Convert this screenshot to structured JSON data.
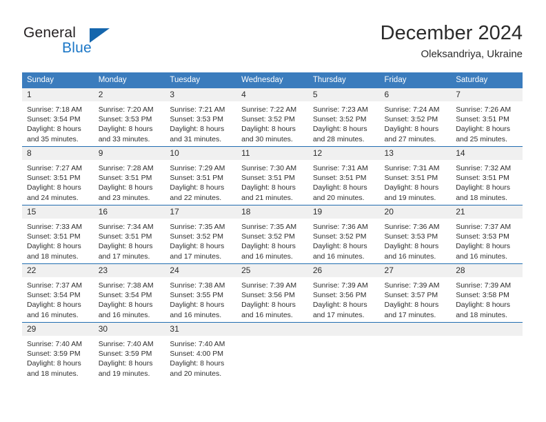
{
  "brand": {
    "name_part1": "General",
    "name_part2": "Blue"
  },
  "header": {
    "title": "December 2024",
    "location": "Oleksandriya, Ukraine"
  },
  "colors": {
    "header_blue": "#3b7cbd",
    "rule_blue": "#1f6cb0",
    "daynum_gray": "#f0f0f0",
    "logo_blue": "#1a76c6"
  },
  "weekdays": [
    "Sunday",
    "Monday",
    "Tuesday",
    "Wednesday",
    "Thursday",
    "Friday",
    "Saturday"
  ],
  "weeks": [
    [
      {
        "day": "1",
        "sunrise": "Sunrise: 7:18 AM",
        "sunset": "Sunset: 3:54 PM",
        "daylight1": "Daylight: 8 hours",
        "daylight2": "and 35 minutes."
      },
      {
        "day": "2",
        "sunrise": "Sunrise: 7:20 AM",
        "sunset": "Sunset: 3:53 PM",
        "daylight1": "Daylight: 8 hours",
        "daylight2": "and 33 minutes."
      },
      {
        "day": "3",
        "sunrise": "Sunrise: 7:21 AM",
        "sunset": "Sunset: 3:53 PM",
        "daylight1": "Daylight: 8 hours",
        "daylight2": "and 31 minutes."
      },
      {
        "day": "4",
        "sunrise": "Sunrise: 7:22 AM",
        "sunset": "Sunset: 3:52 PM",
        "daylight1": "Daylight: 8 hours",
        "daylight2": "and 30 minutes."
      },
      {
        "day": "5",
        "sunrise": "Sunrise: 7:23 AM",
        "sunset": "Sunset: 3:52 PM",
        "daylight1": "Daylight: 8 hours",
        "daylight2": "and 28 minutes."
      },
      {
        "day": "6",
        "sunrise": "Sunrise: 7:24 AM",
        "sunset": "Sunset: 3:52 PM",
        "daylight1": "Daylight: 8 hours",
        "daylight2": "and 27 minutes."
      },
      {
        "day": "7",
        "sunrise": "Sunrise: 7:26 AM",
        "sunset": "Sunset: 3:51 PM",
        "daylight1": "Daylight: 8 hours",
        "daylight2": "and 25 minutes."
      }
    ],
    [
      {
        "day": "8",
        "sunrise": "Sunrise: 7:27 AM",
        "sunset": "Sunset: 3:51 PM",
        "daylight1": "Daylight: 8 hours",
        "daylight2": "and 24 minutes."
      },
      {
        "day": "9",
        "sunrise": "Sunrise: 7:28 AM",
        "sunset": "Sunset: 3:51 PM",
        "daylight1": "Daylight: 8 hours",
        "daylight2": "and 23 minutes."
      },
      {
        "day": "10",
        "sunrise": "Sunrise: 7:29 AM",
        "sunset": "Sunset: 3:51 PM",
        "daylight1": "Daylight: 8 hours",
        "daylight2": "and 22 minutes."
      },
      {
        "day": "11",
        "sunrise": "Sunrise: 7:30 AM",
        "sunset": "Sunset: 3:51 PM",
        "daylight1": "Daylight: 8 hours",
        "daylight2": "and 21 minutes."
      },
      {
        "day": "12",
        "sunrise": "Sunrise: 7:31 AM",
        "sunset": "Sunset: 3:51 PM",
        "daylight1": "Daylight: 8 hours",
        "daylight2": "and 20 minutes."
      },
      {
        "day": "13",
        "sunrise": "Sunrise: 7:31 AM",
        "sunset": "Sunset: 3:51 PM",
        "daylight1": "Daylight: 8 hours",
        "daylight2": "and 19 minutes."
      },
      {
        "day": "14",
        "sunrise": "Sunrise: 7:32 AM",
        "sunset": "Sunset: 3:51 PM",
        "daylight1": "Daylight: 8 hours",
        "daylight2": "and 18 minutes."
      }
    ],
    [
      {
        "day": "15",
        "sunrise": "Sunrise: 7:33 AM",
        "sunset": "Sunset: 3:51 PM",
        "daylight1": "Daylight: 8 hours",
        "daylight2": "and 18 minutes."
      },
      {
        "day": "16",
        "sunrise": "Sunrise: 7:34 AM",
        "sunset": "Sunset: 3:51 PM",
        "daylight1": "Daylight: 8 hours",
        "daylight2": "and 17 minutes."
      },
      {
        "day": "17",
        "sunrise": "Sunrise: 7:35 AM",
        "sunset": "Sunset: 3:52 PM",
        "daylight1": "Daylight: 8 hours",
        "daylight2": "and 17 minutes."
      },
      {
        "day": "18",
        "sunrise": "Sunrise: 7:35 AM",
        "sunset": "Sunset: 3:52 PM",
        "daylight1": "Daylight: 8 hours",
        "daylight2": "and 16 minutes."
      },
      {
        "day": "19",
        "sunrise": "Sunrise: 7:36 AM",
        "sunset": "Sunset: 3:52 PM",
        "daylight1": "Daylight: 8 hours",
        "daylight2": "and 16 minutes."
      },
      {
        "day": "20",
        "sunrise": "Sunrise: 7:36 AM",
        "sunset": "Sunset: 3:53 PM",
        "daylight1": "Daylight: 8 hours",
        "daylight2": "and 16 minutes."
      },
      {
        "day": "21",
        "sunrise": "Sunrise: 7:37 AM",
        "sunset": "Sunset: 3:53 PM",
        "daylight1": "Daylight: 8 hours",
        "daylight2": "and 16 minutes."
      }
    ],
    [
      {
        "day": "22",
        "sunrise": "Sunrise: 7:37 AM",
        "sunset": "Sunset: 3:54 PM",
        "daylight1": "Daylight: 8 hours",
        "daylight2": "and 16 minutes."
      },
      {
        "day": "23",
        "sunrise": "Sunrise: 7:38 AM",
        "sunset": "Sunset: 3:54 PM",
        "daylight1": "Daylight: 8 hours",
        "daylight2": "and 16 minutes."
      },
      {
        "day": "24",
        "sunrise": "Sunrise: 7:38 AM",
        "sunset": "Sunset: 3:55 PM",
        "daylight1": "Daylight: 8 hours",
        "daylight2": "and 16 minutes."
      },
      {
        "day": "25",
        "sunrise": "Sunrise: 7:39 AM",
        "sunset": "Sunset: 3:56 PM",
        "daylight1": "Daylight: 8 hours",
        "daylight2": "and 16 minutes."
      },
      {
        "day": "26",
        "sunrise": "Sunrise: 7:39 AM",
        "sunset": "Sunset: 3:56 PM",
        "daylight1": "Daylight: 8 hours",
        "daylight2": "and 17 minutes."
      },
      {
        "day": "27",
        "sunrise": "Sunrise: 7:39 AM",
        "sunset": "Sunset: 3:57 PM",
        "daylight1": "Daylight: 8 hours",
        "daylight2": "and 17 minutes."
      },
      {
        "day": "28",
        "sunrise": "Sunrise: 7:39 AM",
        "sunset": "Sunset: 3:58 PM",
        "daylight1": "Daylight: 8 hours",
        "daylight2": "and 18 minutes."
      }
    ],
    [
      {
        "day": "29",
        "sunrise": "Sunrise: 7:40 AM",
        "sunset": "Sunset: 3:59 PM",
        "daylight1": "Daylight: 8 hours",
        "daylight2": "and 18 minutes."
      },
      {
        "day": "30",
        "sunrise": "Sunrise: 7:40 AM",
        "sunset": "Sunset: 3:59 PM",
        "daylight1": "Daylight: 8 hours",
        "daylight2": "and 19 minutes."
      },
      {
        "day": "31",
        "sunrise": "Sunrise: 7:40 AM",
        "sunset": "Sunset: 4:00 PM",
        "daylight1": "Daylight: 8 hours",
        "daylight2": "and 20 minutes."
      },
      {
        "day": "",
        "sunrise": "",
        "sunset": "",
        "daylight1": "",
        "daylight2": ""
      },
      {
        "day": "",
        "sunrise": "",
        "sunset": "",
        "daylight1": "",
        "daylight2": ""
      },
      {
        "day": "",
        "sunrise": "",
        "sunset": "",
        "daylight1": "",
        "daylight2": ""
      },
      {
        "day": "",
        "sunrise": "",
        "sunset": "",
        "daylight1": "",
        "daylight2": ""
      }
    ]
  ]
}
